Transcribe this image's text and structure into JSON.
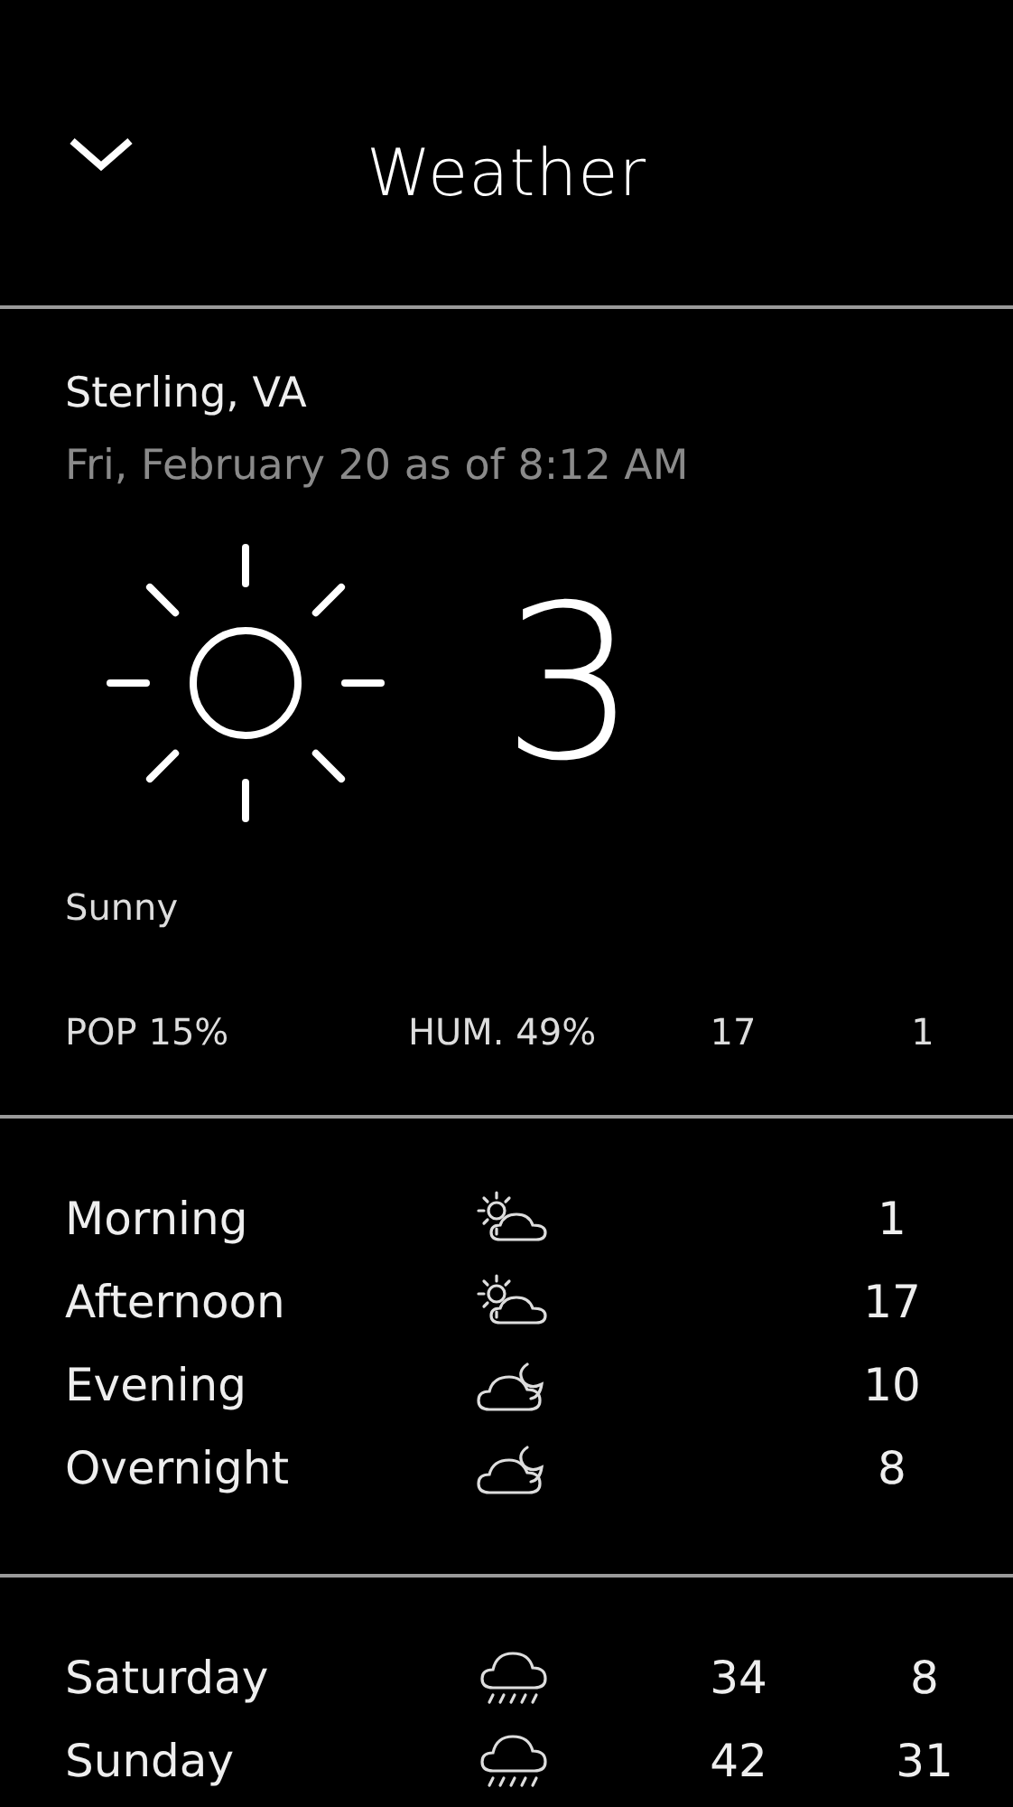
{
  "header": {
    "title": "Weather"
  },
  "current": {
    "location": "Sterling, VA",
    "updated": "Fri, February 20 as of 8:12 AM",
    "temperature": "3",
    "condition": "Sunny",
    "pop": "POP 15%",
    "humidity": "HUM. 49%",
    "high": "17",
    "low": "1"
  },
  "periods": [
    {
      "name": "Morning",
      "kind": "day",
      "temp": "1"
    },
    {
      "name": "Afternoon",
      "kind": "day",
      "temp": "17"
    },
    {
      "name": "Evening",
      "kind": "night",
      "temp": "10"
    },
    {
      "name": "Overnight",
      "kind": "night",
      "temp": "8"
    }
  ],
  "days": [
    {
      "name": "Saturday",
      "kind": "rain",
      "high": "34",
      "low": "8"
    },
    {
      "name": "Sunday",
      "kind": "rain",
      "high": "42",
      "low": "31"
    }
  ]
}
